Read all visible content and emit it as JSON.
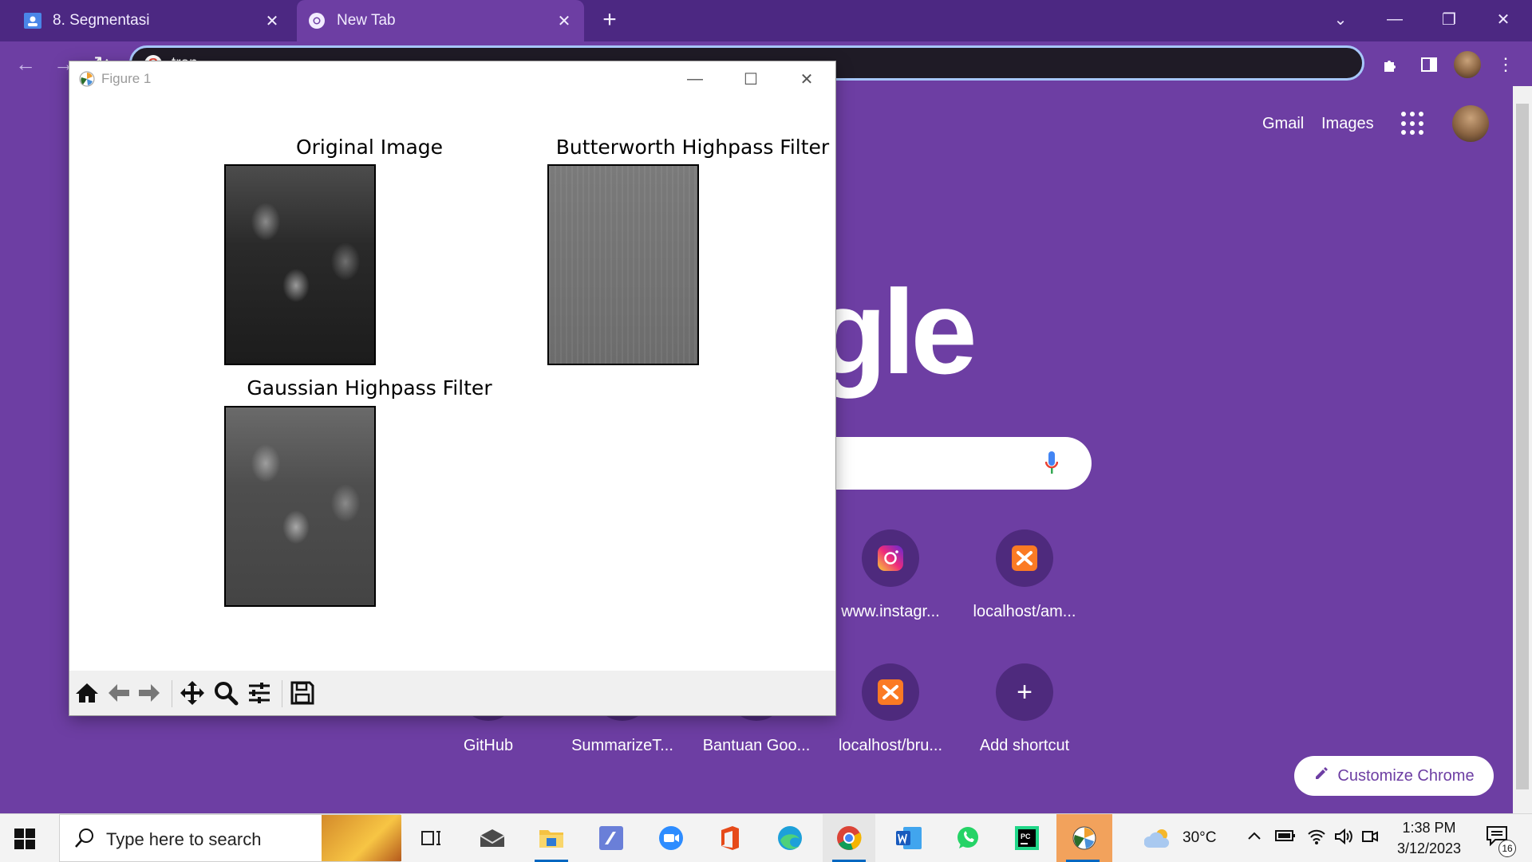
{
  "browser": {
    "tabs": [
      {
        "label": "8. Segmentasi",
        "icon": "classroom-icon"
      },
      {
        "label": "New Tab",
        "icon": "chrome-icon"
      }
    ],
    "omnibox_text": "tran",
    "ntp": {
      "gmail": "Gmail",
      "images": "Images",
      "logo_fragment": "gle",
      "shortcuts_row1": [
        "www.instagr...",
        "localhost/am..."
      ],
      "shortcuts_row2": [
        "GitHub",
        "SummarizeT...",
        "Bantuan Goo...",
        "localhost/bru...",
        "Add shortcut"
      ],
      "customize": "Customize Chrome"
    }
  },
  "figure": {
    "window_title": "Figure 1",
    "subplots": [
      {
        "title": "Original Image"
      },
      {
        "title": "Butterworth Highpass Filter"
      },
      {
        "title": "Gaussian Highpass Filter"
      }
    ],
    "toolbar": [
      "home-icon",
      "back-arrow-icon",
      "forward-arrow-icon",
      "pan-icon",
      "zoom-icon",
      "subplots-config-icon",
      "save-icon"
    ]
  },
  "taskbar": {
    "search_placeholder": "Type here to search",
    "weather": "30°C",
    "time": "1:38 PM",
    "date": "3/12/2023",
    "notifications": "16"
  },
  "colors": {
    "chrome_purple": "#6d3ea3",
    "tabstrip": "#4c2882",
    "omnibox_focus": "#a7c7fa"
  }
}
